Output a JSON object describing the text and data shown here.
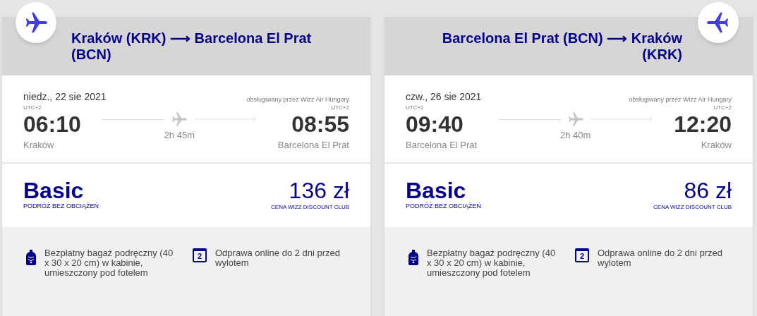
{
  "flights": [
    {
      "route": "Kraków (KRK) ⟶ Barcelona El Prat (BCN)",
      "kind": "outbound",
      "date": "niedz., 22 sie 2021",
      "operator": "obsługiwany przez Wizz Air Hungary",
      "departure": {
        "tz": "UTC+2",
        "time": "06:10",
        "city": "Kraków"
      },
      "duration": "2h 45m",
      "arrival": {
        "tz": "UTC+2",
        "time": "08:55",
        "city": "Barcelona El Prat"
      },
      "fare": "Basic",
      "fare_note": "PODRÓŻ BEZ OBCIĄŻEŃ",
      "price": "136 zł",
      "price_note": "CENA WIZZ DISCOUNT CLUB",
      "features": [
        {
          "kind": "bag",
          "text": "Bezpłatny bagaż podręczny (40 x 30 x 20 cm) w kabinie, umieszczony pod fotelem"
        },
        {
          "kind": "calendar",
          "icon_text": "2",
          "text": "Odprawa online do 2 dni przed wylotem"
        }
      ]
    },
    {
      "route": "Barcelona El Prat (BCN) ⟶ Kraków (KRK)",
      "kind": "return",
      "date": "czw., 26 sie 2021",
      "operator": "obsługiwany przez Wizz Air Hungary",
      "departure": {
        "tz": "UTC+2",
        "time": "09:40",
        "city": "Barcelona El Prat"
      },
      "duration": "2h 40m",
      "arrival": {
        "tz": "UTC+2",
        "time": "12:20",
        "city": "Kraków"
      },
      "fare": "Basic",
      "fare_note": "PODRÓŻ BEZ OBCIĄŻEŃ",
      "price": "86 zł",
      "price_note": "CENA WIZZ DISCOUNT CLUB",
      "features": [
        {
          "kind": "bag",
          "text": "Bezpłatny bagaż podręczny (40 x 30 x 20 cm) w kabinie, umieszczony pod fotelem"
        },
        {
          "kind": "calendar",
          "icon_text": "2",
          "text": "Odprawa online do 2 dni przed wylotem"
        }
      ]
    }
  ]
}
